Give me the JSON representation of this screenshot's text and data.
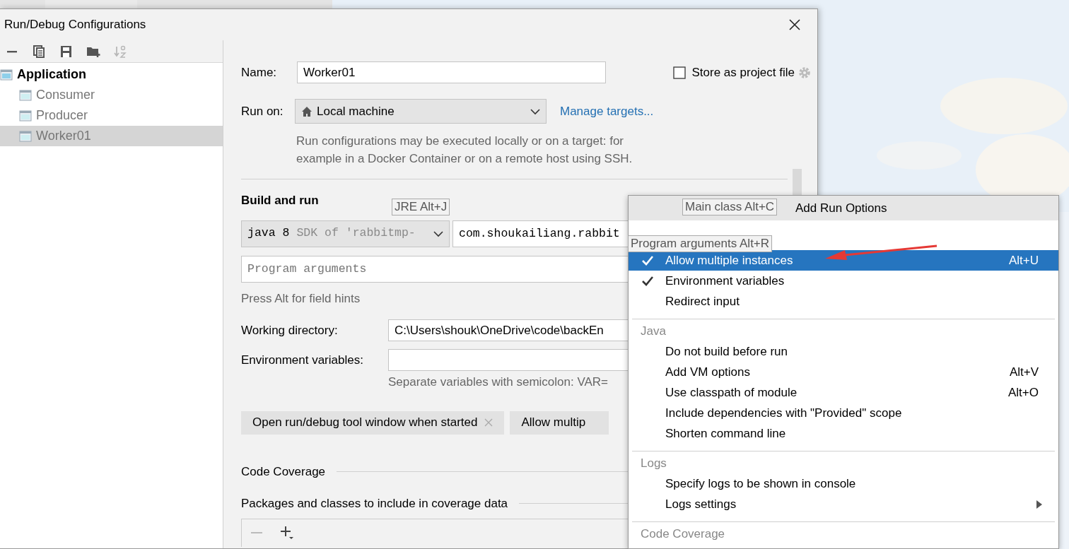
{
  "dialog": {
    "title": "Run/Debug Configurations"
  },
  "toolbar": [
    {
      "kind": "remove",
      "disabled": false
    },
    {
      "kind": "copy",
      "disabled": false
    },
    {
      "kind": "save",
      "disabled": false
    },
    {
      "kind": "folder",
      "disabled": false
    },
    {
      "kind": "sort",
      "disabled": true
    }
  ],
  "tree": [
    {
      "label": "Application",
      "selected": false,
      "children": [
        {
          "label": "Consumer",
          "selected": false
        },
        {
          "label": "Producer",
          "selected": false
        },
        {
          "label": "Worker01",
          "selected": true
        }
      ]
    }
  ],
  "form": {
    "name_label": "Name:",
    "name_value": "Worker01",
    "store_checkbox": {
      "label": "Store as project file",
      "checked": false
    },
    "run_on_label": "Run on:",
    "run_on_value": "Local machine",
    "manage_link": "Manage targets...",
    "run_on_hint": "Run configurations may be executed locally or on a target: for example in a Docker Container or on a remote host using SSH.",
    "build_heading": "Build and run",
    "jre_value": "java 8",
    "jre_hint": "SDK of 'rabbitmp-",
    "main_class_value": "com.shoukailiang.rabbit",
    "program_args_placeholder": "Program arguments",
    "field_hint": "Press Alt for field hints",
    "working_dir_label": "Working directory:",
    "working_dir_value": "C:\\Users\\shouk\\OneDrive\\code\\backEn",
    "env_label": "Environment variables:",
    "env_hint": "Separate variables with semicolon: VAR=",
    "chips": [
      {
        "label": "Open run/debug tool window when started",
        "removable": true
      },
      {
        "label": "Allow multip",
        "removable": false
      }
    ],
    "coverage_heading": "Code Coverage",
    "packages_heading": "Packages and classes to include in coverage data"
  },
  "tooltips": [
    {
      "kind": "jre",
      "label": "JRE Alt+J"
    },
    {
      "kind": "main_class",
      "label": "Main class Alt+C"
    },
    {
      "kind": "program_args",
      "label": "Program arguments Alt+R"
    }
  ],
  "menu": {
    "title": "Add Run Options",
    "sections": [
      {
        "items": [
          {
            "label": "Allow multiple instances",
            "shortcut": "Alt+U",
            "checked": true,
            "selected": true,
            "submenu": false
          },
          {
            "label": "Environment variables",
            "checked": true,
            "selected": false,
            "submenu": false
          },
          {
            "label": "Redirect input",
            "checked": false,
            "selected": false,
            "submenu": false
          }
        ]
      },
      {
        "heading": "Java",
        "items": [
          {
            "label": "Do not build before run",
            "checked": false,
            "selected": false,
            "submenu": false
          },
          {
            "label": "Add VM options",
            "shortcut": "Alt+V",
            "checked": false,
            "selected": false,
            "submenu": false
          },
          {
            "label": "Use classpath of module",
            "shortcut": "Alt+O",
            "checked": false,
            "selected": false,
            "submenu": false
          },
          {
            "label": "Include dependencies with \"Provided\" scope",
            "checked": false,
            "selected": false,
            "submenu": false
          },
          {
            "label": "Shorten command line",
            "checked": false,
            "selected": false,
            "submenu": false
          }
        ]
      },
      {
        "heading": "Logs",
        "items": [
          {
            "label": "Specify logs to be shown in console",
            "checked": false,
            "selected": false,
            "submenu": false
          },
          {
            "label": "Logs settings",
            "checked": false,
            "selected": false,
            "submenu": true
          }
        ]
      },
      {
        "heading": "Code Coverage"
      }
    ]
  }
}
